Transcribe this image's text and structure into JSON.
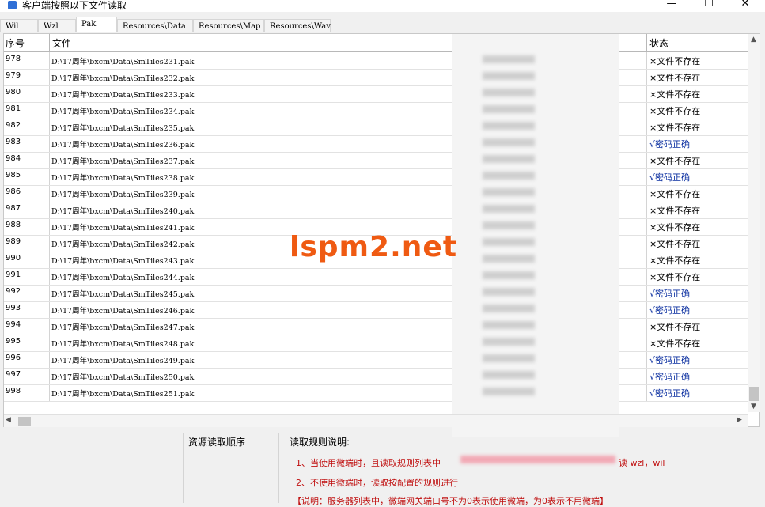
{
  "window": {
    "title": "客户端按照以下文件读取",
    "minimize_label": "—",
    "maximize_label": "☐",
    "close_label": "✕"
  },
  "tabs": [
    {
      "label": "Wil"
    },
    {
      "label": "Wzl"
    },
    {
      "label": "Pak",
      "active": true
    },
    {
      "label": "Resources\\Data"
    },
    {
      "label": "Resources\\Map"
    },
    {
      "label": "Resources\\Wav"
    }
  ],
  "table": {
    "columns": {
      "index": "序号",
      "file": "文件",
      "status": "状态"
    },
    "rows": [
      {
        "index": "978",
        "file": "D:\\17周年\\bxcm\\Data\\SmTiles231.pak",
        "status": "×文件不存在",
        "ok": false
      },
      {
        "index": "979",
        "file": "D:\\17周年\\bxcm\\Data\\SmTiles232.pak",
        "status": "×文件不存在",
        "ok": false
      },
      {
        "index": "980",
        "file": "D:\\17周年\\bxcm\\Data\\SmTiles233.pak",
        "status": "×文件不存在",
        "ok": false
      },
      {
        "index": "981",
        "file": "D:\\17周年\\bxcm\\Data\\SmTiles234.pak",
        "status": "×文件不存在",
        "ok": false
      },
      {
        "index": "982",
        "file": "D:\\17周年\\bxcm\\Data\\SmTiles235.pak",
        "status": "×文件不存在",
        "ok": false
      },
      {
        "index": "983",
        "file": "D:\\17周年\\bxcm\\Data\\SmTiles236.pak",
        "status": "√密码正确",
        "ok": true
      },
      {
        "index": "984",
        "file": "D:\\17周年\\bxcm\\Data\\SmTiles237.pak",
        "status": "×文件不存在",
        "ok": false
      },
      {
        "index": "985",
        "file": "D:\\17周年\\bxcm\\Data\\SmTiles238.pak",
        "status": "√密码正确",
        "ok": true
      },
      {
        "index": "986",
        "file": "D:\\17周年\\bxcm\\Data\\SmTiles239.pak",
        "status": "×文件不存在",
        "ok": false
      },
      {
        "index": "987",
        "file": "D:\\17周年\\bxcm\\Data\\SmTiles240.pak",
        "status": "×文件不存在",
        "ok": false
      },
      {
        "index": "988",
        "file": "D:\\17周年\\bxcm\\Data\\SmTiles241.pak",
        "status": "×文件不存在",
        "ok": false
      },
      {
        "index": "989",
        "file": "D:\\17周年\\bxcm\\Data\\SmTiles242.pak",
        "status": "×文件不存在",
        "ok": false
      },
      {
        "index": "990",
        "file": "D:\\17周年\\bxcm\\Data\\SmTiles243.pak",
        "status": "×文件不存在",
        "ok": false
      },
      {
        "index": "991",
        "file": "D:\\17周年\\bxcm\\Data\\SmTiles244.pak",
        "status": "×文件不存在",
        "ok": false
      },
      {
        "index": "992",
        "file": "D:\\17周年\\bxcm\\Data\\SmTiles245.pak",
        "status": "√密码正确",
        "ok": true
      },
      {
        "index": "993",
        "file": "D:\\17周年\\bxcm\\Data\\SmTiles246.pak",
        "status": "√密码正确",
        "ok": true
      },
      {
        "index": "994",
        "file": "D:\\17周年\\bxcm\\Data\\SmTiles247.pak",
        "status": "×文件不存在",
        "ok": false
      },
      {
        "index": "995",
        "file": "D:\\17周年\\bxcm\\Data\\SmTiles248.pak",
        "status": "×文件不存在",
        "ok": false
      },
      {
        "index": "996",
        "file": "D:\\17周年\\bxcm\\Data\\SmTiles249.pak",
        "status": "√密码正确",
        "ok": true
      },
      {
        "index": "997",
        "file": "D:\\17周年\\bxcm\\Data\\SmTiles250.pak",
        "status": "√密码正确",
        "ok": true
      },
      {
        "index": "998",
        "file": "D:\\17周年\\bxcm\\Data\\SmTiles251.pak",
        "status": "√密码正确",
        "ok": true
      }
    ]
  },
  "bottom": {
    "order_label": "资源读取顺序",
    "rules_label": "读取规则说明:",
    "rules": [
      "1、当使用微端时，且读取规则列表中",
      "2、不使用微端时，读取按配置的规则进行",
      "【说明：服务器列表中，微端网关端口号不为0表示使用微端，为0表示不用微端】"
    ],
    "rule1_tail": "读 wzl，wil"
  },
  "watermark": "lspm2.net",
  "colors": {
    "ok_status": "#0b2fa0",
    "rules_text": "#c01010",
    "watermark": "#ef5a12"
  }
}
